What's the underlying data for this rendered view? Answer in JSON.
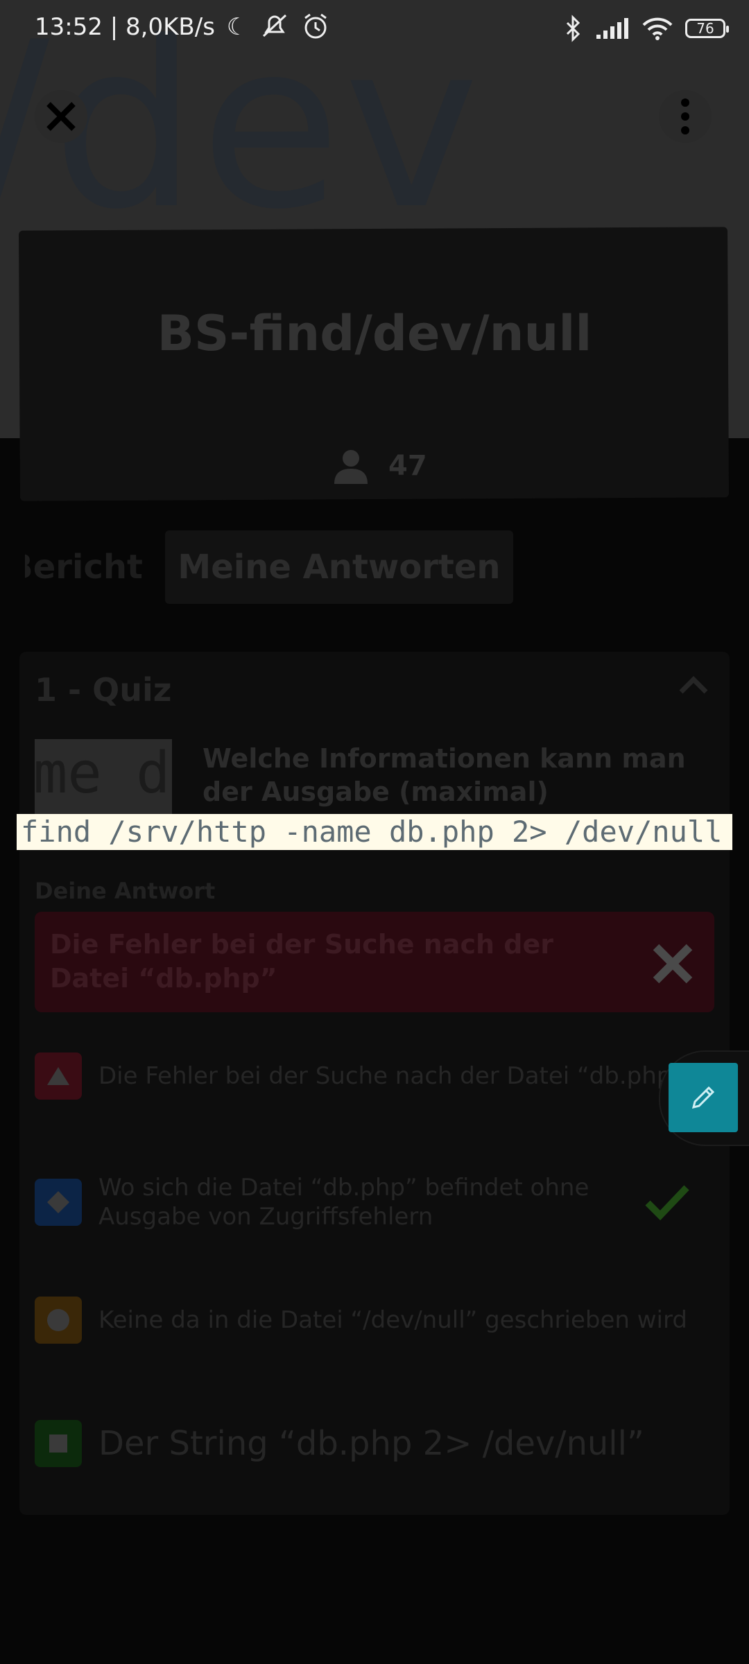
{
  "status_bar": {
    "time_speed": "13:52 | 8,0KB/s",
    "battery": "76"
  },
  "hero": {
    "background_text": "/dev"
  },
  "quiz": {
    "title": "BS-find/dev/null",
    "player_count": "47"
  },
  "tabs": {
    "left_partial": "Bericht",
    "active": "Meine Antworten"
  },
  "question_section": {
    "title": "1 - Quiz",
    "thumbnail_text": "me d",
    "question": "Welche Informationen kann man der Ausgabe (maximal)",
    "code": "find /srv/http -name db.php 2> /dev/null"
  },
  "your_answer": {
    "label": "Deine Antwort",
    "text": "Die Fehler bei der Suche nach der Datei “db.php”"
  },
  "options": [
    {
      "shape": "triangle",
      "color": "#3a0c14",
      "text": "Die Fehler bei der Suche nach der Datei “db.php”",
      "correct": false
    },
    {
      "shape": "diamond",
      "color": "#0c2446",
      "text": "Wo sich die Datei “db.php” befindet ohne Ausgabe von Zugriffsfehlern",
      "correct": true
    },
    {
      "shape": "circle",
      "color": "#3a2708",
      "text": "Keine da in die Datei “/dev/null” geschrieben wird",
      "correct": false
    },
    {
      "shape": "square",
      "color": "#0c2a0c",
      "text": "Der String “db.php 2> /dev/null”",
      "correct": false
    }
  ],
  "colors": {
    "fab": "#0f8797",
    "code_bar": "#fffbe9",
    "wrong_answer": "#2a0910",
    "check": "#1f4a14"
  }
}
